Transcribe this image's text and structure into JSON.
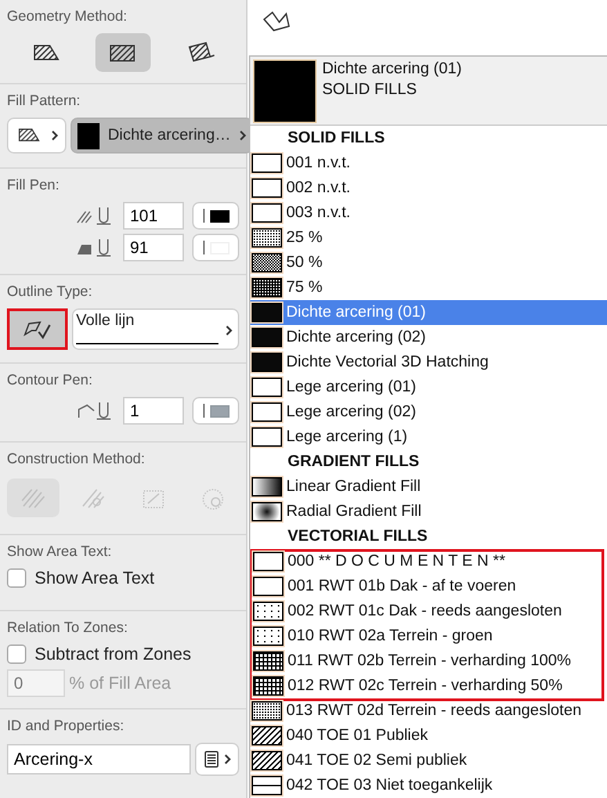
{
  "geometry_method": {
    "label": "Geometry Method:",
    "options": [
      {
        "kind": "polygon",
        "selected": false
      },
      {
        "kind": "rectangle",
        "selected": true
      },
      {
        "kind": "rotated",
        "selected": false
      }
    ]
  },
  "fill_pattern": {
    "label": "Fill Pattern:",
    "value": "Dichte arcering…"
  },
  "fill_pen": {
    "label": "Fill Pen:",
    "rows": [
      {
        "kind": "hatch",
        "value": "101",
        "color": "#000000"
      },
      {
        "kind": "background",
        "value": "91",
        "color": "#ffffff"
      }
    ]
  },
  "outline_type": {
    "label": "Outline Type:",
    "value": "Volle lijn",
    "highlighted": true
  },
  "contour_pen": {
    "label": "Contour Pen:",
    "value": "1",
    "color": "#9aa3ab"
  },
  "construction_method": {
    "label": "Construction Method:",
    "disabled": true,
    "options": [
      {
        "kind": "hatch",
        "selected": true
      },
      {
        "kind": "center",
        "selected": false
      },
      {
        "kind": "distorted",
        "selected": false
      },
      {
        "kind": "radial",
        "selected": false
      }
    ]
  },
  "show_area_text": {
    "label": "Show Area Text:",
    "checkbox": "Show Area Text",
    "checked": false
  },
  "relation_to_zones": {
    "label": "Relation To Zones:",
    "checkbox": "Subtract from Zones",
    "checked": false,
    "percent": {
      "placeholder": "0",
      "label": "% of Fill Area"
    }
  },
  "id_and_properties": {
    "label": "ID and Properties:",
    "value": "Arcering-x"
  },
  "menu": {
    "preview_title": "Dichte arcering (01)",
    "preview_category": "SOLID FILLS",
    "items": [
      {
        "kind": "header",
        "label": "SOLID FILLS"
      },
      {
        "kind": "empty",
        "label": "001 n.v.t.",
        "selected": false,
        "highlighted": false
      },
      {
        "kind": "empty",
        "label": "002 n.v.t.",
        "selected": false,
        "highlighted": false
      },
      {
        "kind": "empty",
        "label": "003 n.v.t.",
        "selected": false,
        "highlighted": false
      },
      {
        "kind": "dots25",
        "label": "25 %",
        "selected": false,
        "highlighted": false
      },
      {
        "kind": "dots50",
        "label": "50 %",
        "selected": false,
        "highlighted": false
      },
      {
        "kind": "dots75",
        "label": "75 %",
        "selected": false,
        "highlighted": false
      },
      {
        "kind": "solid",
        "label": "Dichte arcering (01)",
        "selected": true,
        "highlighted": false
      },
      {
        "kind": "solid",
        "label": "Dichte arcering (02)",
        "selected": false,
        "highlighted": false
      },
      {
        "kind": "solid",
        "label": "Dichte Vectorial 3D Hatching",
        "selected": false,
        "highlighted": false
      },
      {
        "kind": "empty",
        "label": "Lege arcering (01)",
        "selected": false,
        "highlighted": false
      },
      {
        "kind": "empty",
        "label": "Lege arcering (02)",
        "selected": false,
        "highlighted": false
      },
      {
        "kind": "empty",
        "label": "Lege arcering (1)",
        "selected": false,
        "highlighted": false
      },
      {
        "kind": "header",
        "label": "GRADIENT FILLS"
      },
      {
        "kind": "linear",
        "label": "Linear Gradient Fill",
        "selected": false,
        "highlighted": false
      },
      {
        "kind": "radial",
        "label": "Radial Gradient Fill",
        "selected": false,
        "highlighted": false
      },
      {
        "kind": "header",
        "label": "VECTORIAL FILLS"
      },
      {
        "kind": "empty",
        "label": "000 ** D O C U M E N T E N **",
        "selected": false,
        "highlighted": true
      },
      {
        "kind": "empty",
        "label": "001 RWT 01b Dak - af te voeren",
        "selected": false,
        "highlighted": true
      },
      {
        "kind": "sparse",
        "label": "002 RWT 01c Dak - reeds aangesloten",
        "selected": false,
        "highlighted": true
      },
      {
        "kind": "sparse",
        "label": "010 RWT 02a Terrein - groen",
        "selected": false,
        "highlighted": true
      },
      {
        "kind": "grid",
        "label": "011 RWT 02b Terrein - verharding 100%",
        "selected": false,
        "highlighted": true
      },
      {
        "kind": "grid",
        "label": "012 RWT 02c Terrein - verharding 50%",
        "selected": false,
        "highlighted": true
      },
      {
        "kind": "fine",
        "label": "013 RWT 02d Terrein - reeds aangesloten",
        "selected": false,
        "highlighted": false
      },
      {
        "kind": "hatch",
        "label": "040 TOE 01 Publiek",
        "selected": false,
        "highlighted": false
      },
      {
        "kind": "hatch",
        "label": "041 TOE 02 Semi publiek",
        "selected": false,
        "highlighted": false
      },
      {
        "kind": "line",
        "label": "042 TOE 03 Niet toegankelijk",
        "selected": false,
        "highlighted": false
      }
    ]
  }
}
